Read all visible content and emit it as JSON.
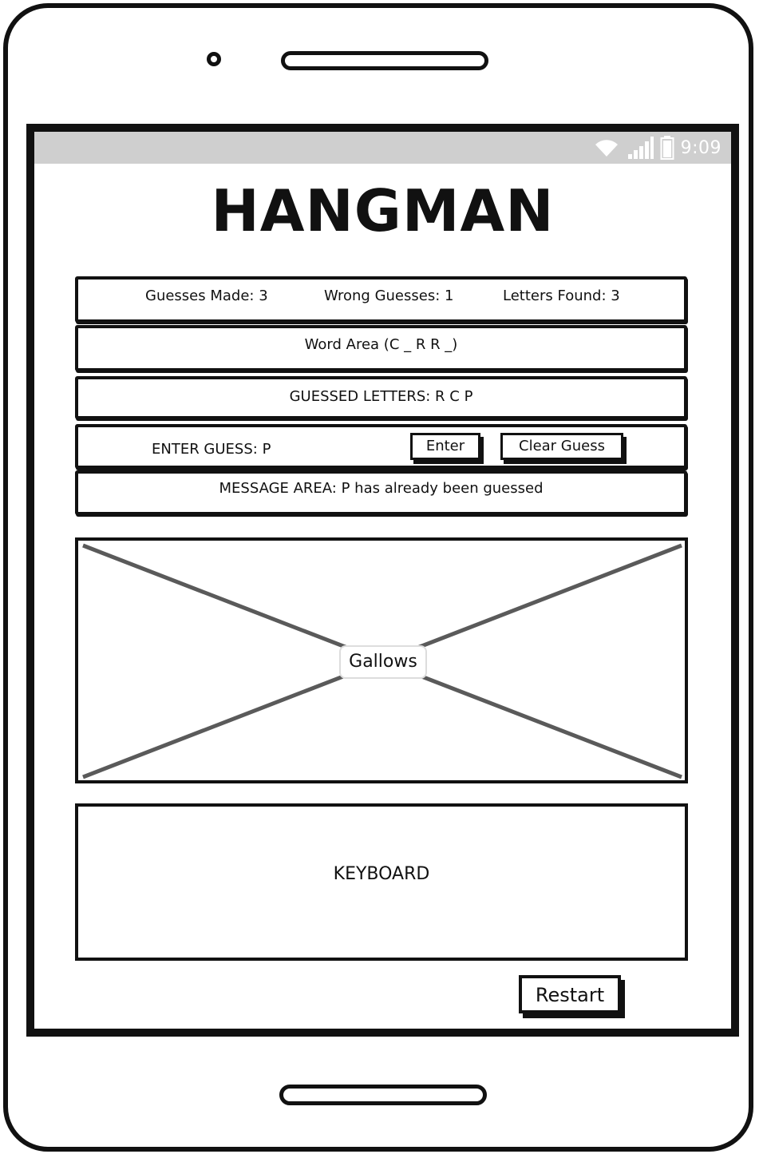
{
  "status_bar": {
    "time": "9:09",
    "icons": [
      "wifi-icon",
      "signal-icon",
      "battery-icon"
    ]
  },
  "title": "HANGMAN",
  "stats": {
    "guesses_made": "Guesses Made: 3",
    "wrong_guesses": "Wrong Guesses: 1",
    "letters_found": "Letters Found: 3"
  },
  "word_area": "Word Area (C _ R R _)",
  "guessed_letters": "GUESSED LETTERS: R C P",
  "guess_entry": {
    "label": "ENTER GUESS: P",
    "enter_label": "Enter",
    "clear_label": "Clear Guess"
  },
  "message_area": "MESSAGE AREA: P has already been guessed",
  "gallows": {
    "label": "Gallows"
  },
  "keyboard": {
    "label": "KEYBOARD"
  },
  "restart_label": "Restart",
  "colors": {
    "outline": "#111111",
    "statusbar": "#cfcfcf",
    "placeholder_cross": "#5a5a5a"
  }
}
